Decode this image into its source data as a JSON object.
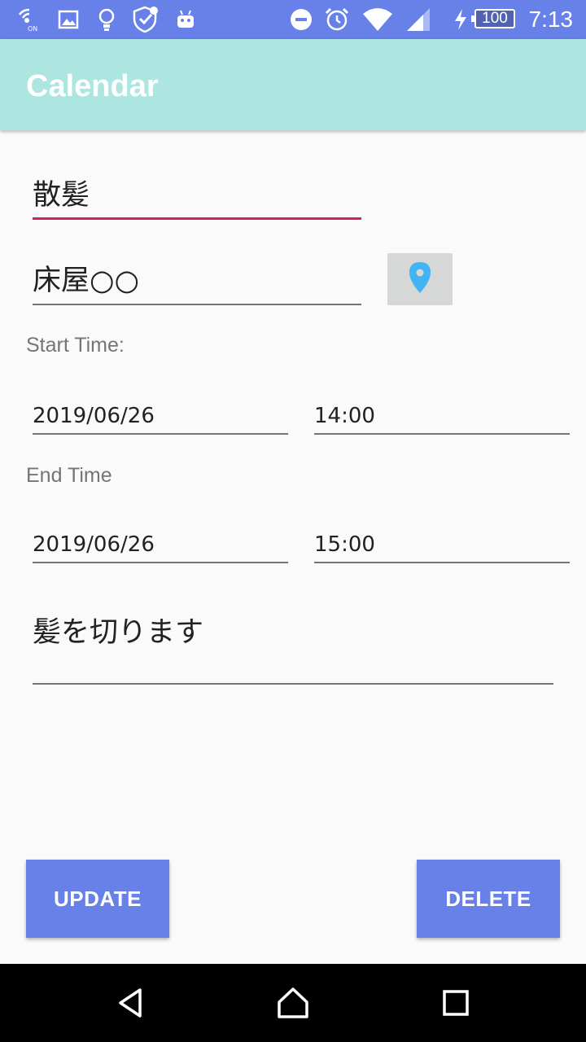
{
  "status_bar": {
    "time": "7:13",
    "battery": "100",
    "icons": [
      "wifi-calling-icon",
      "gallery-icon",
      "bulb-icon",
      "shield-icon",
      "android-icon",
      "dnd-icon",
      "alarm-icon",
      "wifi-icon",
      "signal-icon",
      "charging-icon"
    ]
  },
  "app_bar": {
    "title": "Calendar"
  },
  "form": {
    "title_value": "散髪",
    "location_value": "床屋○○",
    "start_label": "Start Time:",
    "start_date": "2019/06/26",
    "start_time": "14:00",
    "end_label": "End Time",
    "end_date": "2019/06/26",
    "end_time": "15:00",
    "description_value": "髪を切ります"
  },
  "buttons": {
    "update": "UPDATE",
    "delete": "DELETE"
  },
  "colors": {
    "status_bar": "#6781e8",
    "app_bar": "#ade6e0",
    "accent_underline": "#d3225c",
    "button": "#6781e8",
    "location_pin": "#42b4f4"
  },
  "nav_bar": {
    "icons": [
      "back-icon",
      "home-icon",
      "recents-icon"
    ]
  }
}
